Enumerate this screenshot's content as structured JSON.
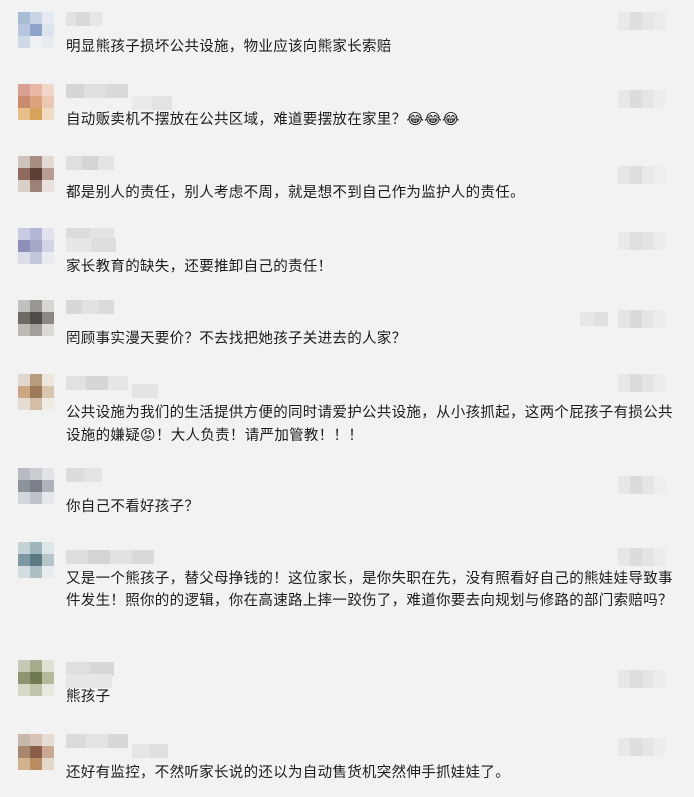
{
  "comments": [
    {
      "text": "明显熊孩子损坏公共设施，物业应该向熊家长索赔",
      "emoji": ""
    },
    {
      "text": "自动贩卖机不摆放在公共区域，难道要摆放在家里？",
      "emoji": "😂😂😂"
    },
    {
      "text": "都是别人的责任，别人考虑不周，就是想不到自己作为监护人的责任。",
      "emoji": ""
    },
    {
      "text": "家长教育的缺失，还要推卸自己的责任！",
      "emoji": ""
    },
    {
      "text": "罔顾事实漫天要价？不去找把她孩子关进去的人家？",
      "emoji": ""
    },
    {
      "text": "公共设施为我们的生活提供方便的同时请爱护公共设施，从小孩抓起，这两个屁孩子有损公共设施的嫌疑",
      "emoji": "😡",
      "text_after": "！大人负责！请严加管教！！！"
    },
    {
      "text": "你自己不看好孩子？",
      "emoji": ""
    },
    {
      "text": "又是一个熊孩子，替父母挣钱的！这位家长，是你失职在先，没有照看好自己的熊娃娃导致事件发生！照你的的逻辑，你在高速路上摔一跤伤了，难道你要去向规划与修路的部门索赔吗？",
      "emoji": ""
    },
    {
      "text": "熊孩子",
      "emoji": ""
    },
    {
      "text": "还好有监控，不然听家长说的还以为自动售货机突然伸手抓娃娃了。",
      "emoji": ""
    }
  ],
  "colors": {
    "background": "#f2f2f2",
    "text": "#1c1c1c",
    "blur_light": "#e6e6e6",
    "blur_mid": "#d8d8d8"
  },
  "icons": {
    "avatar": "avatar-blurred",
    "laugh": "face-with-tears-of-joy",
    "angry": "angry-face"
  }
}
